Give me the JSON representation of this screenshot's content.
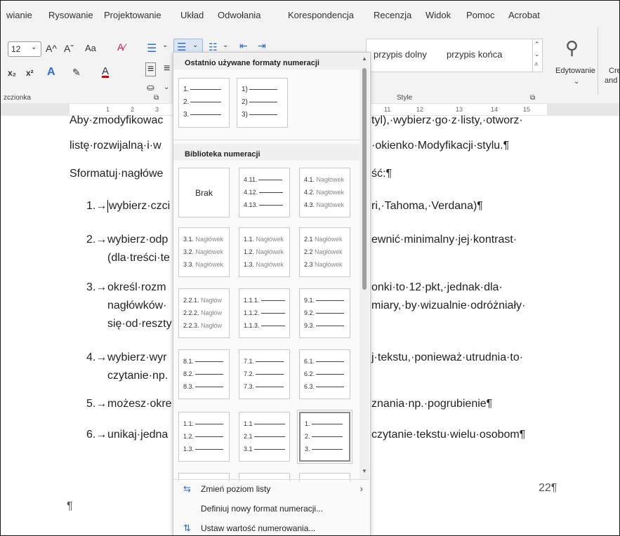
{
  "menu": [
    "wianie",
    "Rysowanie",
    "Projektowanie",
    "Układ",
    "Odwołania",
    "Korespondencja",
    "Recenzja",
    "Widok",
    "Pomoc",
    "Acrobat"
  ],
  "ribbon": {
    "font_size": "12",
    "font_group_label": "zczionka",
    "style_group_label": "Style",
    "style_items": [
      "przypis dolny",
      "przypis końca"
    ],
    "edit_label": "Edytowanie",
    "edit_extra": "Cre",
    "edit_extra2": "and",
    "aa": "Aa",
    "grow": "A^",
    "shrink": "Aˇ",
    "sub": "x₂",
    "sup": "x²"
  },
  "ruler": [
    "1",
    "2",
    "3",
    "11",
    "12",
    "13",
    "14",
    "15"
  ],
  "doc": {
    "line0": "Aby·zmodyfikowac",
    "line0r": "tyl),·wybierz·go·z·listy,·otworz·",
    "line1": "listę·rozwijalną·i·w",
    "line1r": "·okienko·Modyfikacji·stylu.¶",
    "line2": "Sformatuj·nagłówe",
    "line2r": "ść:¶",
    "items": [
      {
        "n": "1.→",
        "l": "wybierz·czci",
        "r": "ri,·Tahoma,·Verdana)¶"
      },
      {
        "n": "2.→",
        "l": "wybierz·odp",
        "r": "ewnić·minimalny·jej·kontrast·",
        "l2": "(dla·treści·te"
      },
      {
        "n": "3.→",
        "l": "określ·rozm",
        "r": "onki·to·12·pkt,·jednak·dla·",
        "l2": "nagłówków·",
        "r2": "miary,·by·wizualnie·odróżniały·",
        "l3": "się·od·reszty"
      },
      {
        "n": "4.→",
        "l": "wybierz·wyr",
        "r": "j·tekstu,·ponieważ·utrudnia·to·",
        "l2": "czytanie·np."
      },
      {
        "n": "5.→",
        "l": "możesz·okre",
        "r": "znania·np.·pogrubienie¶"
      },
      {
        "n": "6.→",
        "l": "unikaj·jedna",
        "r": "czytanie·tekstu·wielu·osobom¶"
      }
    ],
    "page_number": "22¶",
    "pilcrow": "¶"
  },
  "dropdown": {
    "recent_title": "Ostatnio używane formaty numeracji",
    "library_title": "Biblioteka numeracji",
    "recent": [
      [
        "1.",
        "2.",
        "3."
      ],
      [
        "1)",
        "2)",
        "3)"
      ]
    ],
    "none_label": "Brak",
    "library": [
      [
        [
          "4.11.",
          ""
        ],
        [
          "4.12.",
          ""
        ],
        [
          "4.13.",
          ""
        ]
      ],
      [
        [
          "4.1.",
          "Nagłówek"
        ],
        [
          "4.2.",
          "Nagłówek"
        ],
        [
          "4.3.",
          "Nagłówek"
        ]
      ],
      [
        [
          "3.1.",
          "Nagłówek"
        ],
        [
          "3.2.",
          "Nagłówek"
        ],
        [
          "3.3.",
          "Nagłówek"
        ]
      ],
      [
        [
          "1.1.",
          "Nagłówek"
        ],
        [
          "1.2.",
          "Nagłówek"
        ],
        [
          "1.3.",
          "Nagłówek"
        ]
      ],
      [
        [
          "2.1",
          "Nagłówek"
        ],
        [
          "2.2",
          "Nagłówek"
        ],
        [
          "2.3",
          "Nagłówek"
        ]
      ],
      [
        [
          "2.2.1.",
          "Nagłów"
        ],
        [
          "2.2.2.",
          "Nagłów"
        ],
        [
          "2.2.3.",
          "Nagłów"
        ]
      ],
      [
        [
          "1.1.1.",
          ""
        ],
        [
          "1.1.2.",
          ""
        ],
        [
          "1.1.3.",
          ""
        ]
      ],
      [
        [
          "9.1.",
          ""
        ],
        [
          "9.2.",
          ""
        ],
        [
          "9.3.",
          ""
        ]
      ],
      [
        [
          "8.1.",
          ""
        ],
        [
          "8.2.",
          ""
        ],
        [
          "8.3.",
          ""
        ]
      ],
      [
        [
          "7.1.",
          ""
        ],
        [
          "7.2.",
          ""
        ],
        [
          "7.3.",
          ""
        ]
      ],
      [
        [
          "6.1.",
          ""
        ],
        [
          "6.2.",
          ""
        ],
        [
          "6.3.",
          ""
        ]
      ],
      [
        [
          "1.1.",
          ""
        ],
        [
          "1.2.",
          ""
        ],
        [
          "1.3.",
          ""
        ]
      ],
      [
        [
          "1.1",
          ""
        ],
        [
          "2.1",
          ""
        ],
        [
          "3.1",
          ""
        ]
      ],
      [
        [
          "1.",
          ""
        ],
        [
          "2.",
          ""
        ],
        [
          "3.",
          ""
        ]
      ]
    ],
    "menu_change_level": "Zmień poziom listy",
    "menu_define": "Definiuj nowy format numeracji...",
    "menu_set_value": "Ustaw wartość numerowania..."
  }
}
